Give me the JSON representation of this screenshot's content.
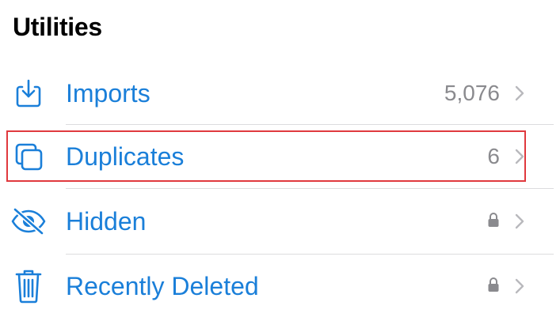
{
  "section": {
    "title": "Utilities"
  },
  "rows": [
    {
      "label": "Imports",
      "count": "5,076",
      "icon": "import-tray-icon",
      "locked": false
    },
    {
      "label": "Duplicates",
      "count": "6",
      "icon": "duplicates-icon",
      "locked": false
    },
    {
      "label": "Hidden",
      "count": "",
      "icon": "eye-slash-icon",
      "locked": true
    },
    {
      "label": "Recently Deleted",
      "count": "",
      "icon": "trash-icon",
      "locked": true
    }
  ],
  "colors": {
    "accent": "#1a7fd9",
    "secondary_text": "#8a8a8e",
    "divider": "#dcdcde",
    "highlight": "#e0393e"
  },
  "highlighted_row": "Duplicates"
}
